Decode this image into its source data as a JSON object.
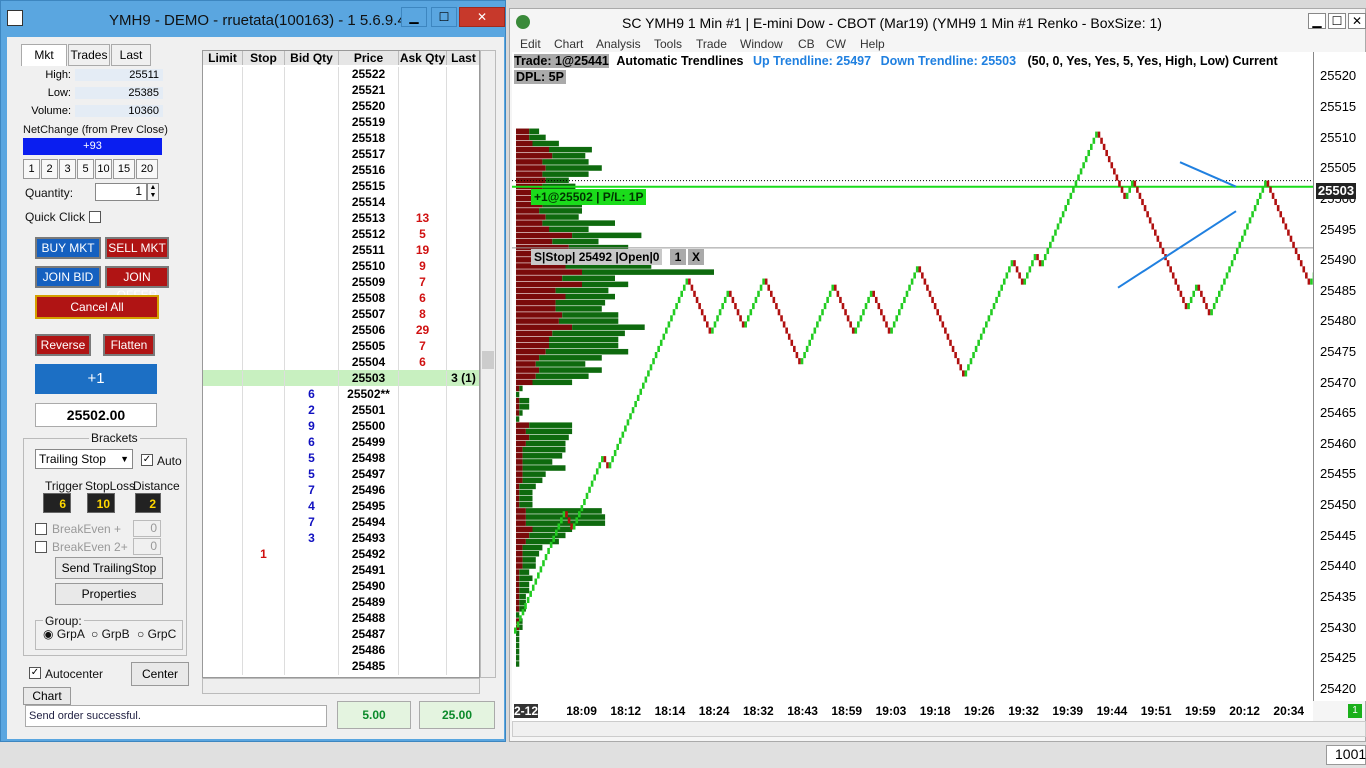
{
  "left_window": {
    "title": "YMH9 - DEMO - rruetata(100163) - 1 5.6.9.4",
    "min": "▁",
    "max": "☐",
    "close": "✕"
  },
  "tabs": [
    "Mkt",
    "Trades",
    "Last"
  ],
  "stats": {
    "high_label": "High:",
    "high": "25511",
    "low_label": "Low:",
    "low": "25385",
    "vol_label": "Volume:",
    "volume": "10360",
    "netchange_label": "NetChange (from Prev Close)",
    "netchange": "+93"
  },
  "qty_presets": [
    "1",
    "2",
    "3",
    "5",
    "10",
    "15",
    "20"
  ],
  "quantity": {
    "label": "Quantity:",
    "value": "1"
  },
  "quick_click": "Quick Click",
  "buttons": {
    "buy_mkt": "BUY MKT",
    "sell_mkt": "SELL MKT",
    "join_bid": "JOIN BID",
    "join_offer": "JOIN OFFER",
    "cancel_all": "Cancel All",
    "reverse": "Reverse",
    "flatten": "Flatten",
    "position": "+1",
    "price": "25502.00"
  },
  "brackets": {
    "title": "Brackets",
    "mode": "Trailing Stop",
    "auto": "Auto",
    "trigger_label": "Trigger",
    "stoploss_label": "StopLoss",
    "distance_label": "Distance",
    "trigger": "6",
    "stoploss": "10",
    "distance": "2",
    "breakeven1": "BreakEven +",
    "breakeven1_val": "0",
    "breakeven2": "BreakEven 2+",
    "breakeven2_val": "0",
    "send": "Send TrailingStop",
    "properties": "Properties",
    "group_label": "Group:",
    "groups": [
      "GrpA",
      "GrpB",
      "GrpC"
    ]
  },
  "autocenter": "Autocenter",
  "center": "Center",
  "chart_btn": "Chart",
  "status": {
    "message": "Send order successful.",
    "v1": "5.00",
    "v2": "25.00"
  },
  "ladder": {
    "headers": [
      "Limit",
      "Stop",
      "Bid Qty",
      "Price",
      "Ask Qty",
      "Last"
    ],
    "rows": [
      {
        "price": "25522"
      },
      {
        "price": "25521"
      },
      {
        "price": "25520"
      },
      {
        "price": "25519"
      },
      {
        "price": "25518"
      },
      {
        "price": "25517"
      },
      {
        "price": "25516"
      },
      {
        "price": "25515"
      },
      {
        "price": "25514"
      },
      {
        "price": "25513",
        "ask": "13"
      },
      {
        "price": "25512",
        "ask": "5"
      },
      {
        "price": "25511",
        "ask": "19"
      },
      {
        "price": "25510",
        "ask": "9"
      },
      {
        "price": "25509",
        "ask": "7"
      },
      {
        "price": "25508",
        "ask": "6"
      },
      {
        "price": "25507",
        "ask": "8"
      },
      {
        "price": "25506",
        "ask": "29"
      },
      {
        "price": "25505",
        "ask": "7"
      },
      {
        "price": "25504",
        "ask": "6"
      },
      {
        "price": "25503",
        "last": "3 (1)",
        "hl": true
      },
      {
        "price": "25502**",
        "bid": "6"
      },
      {
        "price": "25501",
        "bid": "2"
      },
      {
        "price": "25500",
        "bid": "9"
      },
      {
        "price": "25499",
        "bid": "6"
      },
      {
        "price": "25498",
        "bid": "5"
      },
      {
        "price": "25497",
        "bid": "5"
      },
      {
        "price": "25496",
        "bid": "7"
      },
      {
        "price": "25495",
        "bid": "4"
      },
      {
        "price": "25494",
        "bid": "7"
      },
      {
        "price": "25493",
        "bid": "3"
      },
      {
        "price": "25492",
        "stop": "1"
      },
      {
        "price": "25491"
      },
      {
        "price": "25490"
      },
      {
        "price": "25489"
      },
      {
        "price": "25488"
      },
      {
        "price": "25487"
      },
      {
        "price": "25486"
      },
      {
        "price": "25485"
      }
    ]
  },
  "chart_window": {
    "title": "SC YMH9  1 Min   #1 | E-mini Dow - CBOT (Mar19) (YMH9  1 Min   #1 Renko - BoxSize: 1)",
    "menu": [
      "Edit",
      "Chart",
      "Analysis",
      "Tools",
      "Trade",
      "Window",
      "CB",
      "CW",
      "Help"
    ],
    "trade": "Trade: 1@25441",
    "study": "Automatic Trendlines",
    "up": "Up Trendline: 25497",
    "down": "Down Trendline: 25503",
    "params": "(50, 0, Yes, Yes, 5, Yes, High, Low)  Current",
    "dpl": "DPL: 5P",
    "position_tag": "+1@25502 | P/L: 1P",
    "stop_tag": "S|Stop| 25492 |Open|0",
    "stop_qty": "1",
    "stop_x": "X",
    "last_price": "25503",
    "sub": "1",
    "status_right": "1001"
  },
  "chart_data": {
    "type": "renko",
    "yticks": [
      "25520",
      "25515",
      "25510",
      "25505",
      "25500",
      "25495",
      "25490",
      "25485",
      "25480",
      "25475",
      "25470",
      "25465",
      "25460",
      "25455",
      "25450",
      "25445",
      "25440",
      "25435",
      "25430",
      "25425",
      "25420"
    ],
    "xticks": [
      "2-12",
      "18:09",
      "18:12",
      "18:14",
      "18:24",
      "18:32",
      "18:43",
      "18:59",
      "19:03",
      "19:18",
      "19:26",
      "19:32",
      "19:39",
      "19:44",
      "19:51",
      "19:59",
      "20:12",
      "20:34"
    ],
    "ylim": [
      25418,
      25524
    ],
    "path": [
      25429,
      25449,
      25446,
      25458,
      25456,
      25487,
      25478,
      25485,
      25479,
      25487,
      25473,
      25486,
      25478,
      25485,
      25478,
      25489,
      25477,
      25471,
      25490,
      25486,
      25491,
      25489,
      25511,
      25500,
      25503,
      25482,
      25486,
      25481,
      25503,
      25486,
      25492,
      25486,
      25506,
      25495,
      25503
    ],
    "profile": [
      [
        25511,
        4,
        3
      ],
      [
        25510,
        4,
        5
      ],
      [
        25509,
        5,
        8
      ],
      [
        25508,
        10,
        13
      ],
      [
        25507,
        11,
        10
      ],
      [
        25506,
        8,
        14
      ],
      [
        25505,
        9,
        17
      ],
      [
        25504,
        8,
        14
      ],
      [
        25503,
        9,
        7
      ],
      [
        25502,
        8,
        10
      ],
      [
        25501,
        7,
        10
      ],
      [
        25500,
        7,
        13
      ],
      [
        25499,
        8,
        12
      ],
      [
        25498,
        7,
        13
      ],
      [
        25497,
        9,
        10
      ],
      [
        25496,
        8,
        22
      ],
      [
        25495,
        10,
        12
      ],
      [
        25494,
        17,
        21
      ],
      [
        25493,
        11,
        14
      ],
      [
        25492,
        16,
        18
      ],
      [
        25491,
        14,
        20
      ],
      [
        25490,
        20,
        18
      ],
      [
        25489,
        15,
        26
      ],
      [
        25488,
        20,
        40
      ],
      [
        25487,
        14,
        16
      ],
      [
        25486,
        20,
        14
      ],
      [
        25485,
        12,
        16
      ],
      [
        25484,
        15,
        15
      ],
      [
        25483,
        12,
        15
      ],
      [
        25482,
        12,
        14
      ],
      [
        25481,
        14,
        17
      ],
      [
        25480,
        13,
        18
      ],
      [
        25479,
        17,
        22
      ],
      [
        25478,
        11,
        22
      ],
      [
        25477,
        10,
        21
      ],
      [
        25476,
        10,
        21
      ],
      [
        25475,
        9,
        25
      ],
      [
        25474,
        7,
        19
      ],
      [
        25473,
        6,
        15
      ],
      [
        25472,
        7,
        19
      ],
      [
        25471,
        6,
        16
      ],
      [
        25470,
        5,
        12
      ],
      [
        25469,
        1,
        1
      ],
      [
        25468,
        0,
        1
      ],
      [
        25467,
        1,
        3
      ],
      [
        25466,
        1,
        3
      ],
      [
        25465,
        1,
        1
      ],
      [
        25464,
        0,
        1
      ],
      [
        25463,
        4,
        13
      ],
      [
        25462,
        3,
        14
      ],
      [
        25461,
        4,
        12
      ],
      [
        25460,
        3,
        12
      ],
      [
        25459,
        2,
        13
      ],
      [
        25458,
        2,
        12
      ],
      [
        25457,
        2,
        9
      ],
      [
        25456,
        2,
        13
      ],
      [
        25455,
        2,
        7
      ],
      [
        25454,
        2,
        6
      ],
      [
        25453,
        1,
        5
      ],
      [
        25452,
        1,
        4
      ],
      [
        25451,
        1,
        4
      ],
      [
        25450,
        1,
        4
      ],
      [
        25449,
        3,
        23
      ],
      [
        25448,
        3,
        24
      ],
      [
        25447,
        3,
        24
      ],
      [
        25446,
        5,
        12
      ],
      [
        25445,
        4,
        11
      ],
      [
        25444,
        3,
        10
      ],
      [
        25443,
        2,
        6
      ],
      [
        25442,
        2,
        5
      ],
      [
        25441,
        2,
        4
      ],
      [
        25440,
        2,
        4
      ],
      [
        25439,
        1,
        3
      ],
      [
        25438,
        1,
        4
      ],
      [
        25437,
        1,
        3
      ],
      [
        25436,
        1,
        3
      ],
      [
        25435,
        1,
        2
      ],
      [
        25434,
        1,
        2
      ],
      [
        25433,
        1,
        2
      ],
      [
        25432,
        0,
        1
      ],
      [
        25431,
        1,
        1
      ],
      [
        25430,
        1,
        1
      ],
      [
        25429,
        0,
        1
      ],
      [
        25428,
        0,
        1
      ],
      [
        25427,
        0,
        1
      ],
      [
        25426,
        0,
        1
      ],
      [
        25425,
        0,
        1
      ],
      [
        25424,
        0,
        1
      ]
    ]
  }
}
